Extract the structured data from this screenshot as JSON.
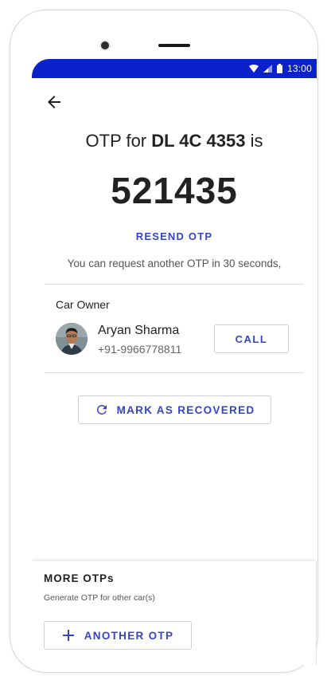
{
  "status_bar": {
    "time": "13:00",
    "icons": [
      "wifi-icon",
      "signal-icon",
      "battery-icon"
    ],
    "color": "#0a22cc"
  },
  "header": {
    "back_icon": "arrow-left-icon"
  },
  "otp": {
    "title_prefix": "OTP for ",
    "vehicle_number": "DL 4C 4353",
    "title_suffix": " is",
    "code": "521435",
    "resend_label": "RESEND OTP",
    "resend_note": "You can request another OTP in 30 seconds,"
  },
  "owner": {
    "section_label": "Car Owner",
    "name": "Aryan Sharma",
    "phone": "+91-9966778811",
    "call_label": "CALL"
  },
  "actions": {
    "mark_recovered_label": "MARK AS RECOVERED",
    "mark_recovered_icon": "refresh-icon"
  },
  "more_otps": {
    "title": "MORE OTPs",
    "subtitle": "Generate OTP for other car(s)",
    "another_otp_label": "ANOTHER OTP",
    "another_otp_icon": "plus-icon"
  },
  "colors": {
    "accent": "#3445c7",
    "text": "#222222"
  }
}
